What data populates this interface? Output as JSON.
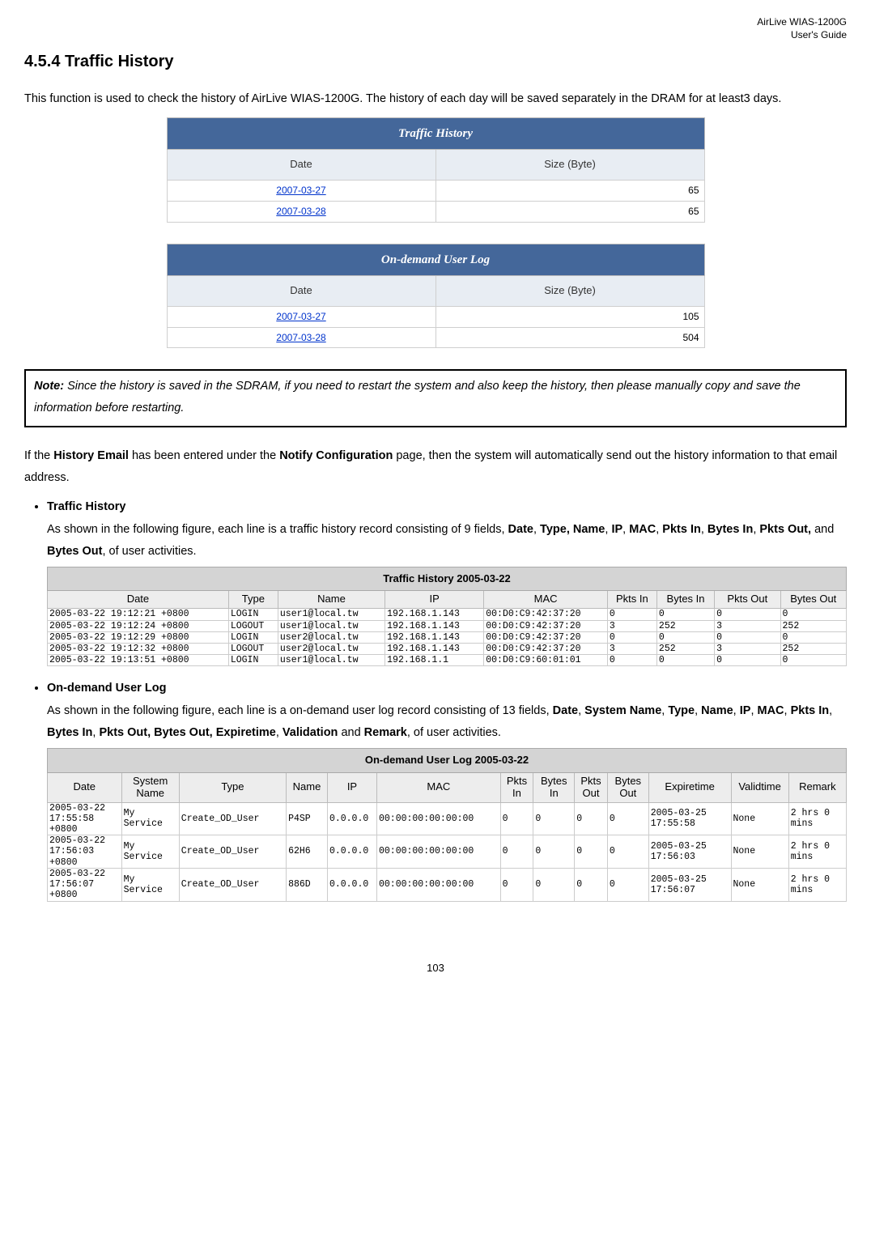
{
  "header": {
    "product": "AirLive WIAS-1200G",
    "doc": "User's Guide"
  },
  "section_title": "4.5.4 Traffic History",
  "intro": "This function is used to check the history of AirLive WIAS-1200G. The history of each day will be saved separately in the DRAM for at least3 days.",
  "summary_tables": [
    {
      "title": "Traffic History",
      "headers": [
        "Date",
        "Size (Byte)"
      ],
      "rows": [
        {
          "date": "2007-03-27",
          "size": "65"
        },
        {
          "date": "2007-03-28",
          "size": "65"
        }
      ]
    },
    {
      "title": "On-demand User Log",
      "headers": [
        "Date",
        "Size (Byte)"
      ],
      "rows": [
        {
          "date": "2007-03-27",
          "size": "105"
        },
        {
          "date": "2007-03-28",
          "size": "504"
        }
      ]
    }
  ],
  "note": {
    "label": "Note:",
    "text": " Since the history is saved in the SDRAM, if you need to restart the system and also keep the history, then please manually copy and save the information before restarting."
  },
  "after_note_pre": "If the ",
  "after_note_b1": "History Email",
  "after_note_mid": " has been entered under the ",
  "after_note_b2": "Notify Configuration",
  "after_note_post": " page, then the system will automatically send out the history information to that email address.",
  "bullets": [
    {
      "title": "Traffic History",
      "body_parts": [
        "As shown in the following figure, each line is a traffic history record consisting of 9 fields, ",
        "Date",
        ", ",
        "Type, Name",
        ", ",
        "IP",
        ", ",
        "MAC",
        ", ",
        "Pkts In",
        ", ",
        "Bytes In",
        ", ",
        "Pkts Out,",
        " and ",
        "Bytes Out",
        ", of user activities."
      ],
      "strong_indices": [
        1,
        3,
        5,
        7,
        9,
        11,
        13,
        15
      ]
    },
    {
      "title": "On-demand User Log",
      "body_parts": [
        "As shown in the following figure, each line is a on-demand user log record consisting of 13 fields, ",
        "Date",
        ", ",
        "System Name",
        ", ",
        "Type",
        ", ",
        "Name",
        ", ",
        "IP",
        ", ",
        "MAC",
        ", ",
        "Pkts In",
        ", ",
        "Bytes In",
        ", ",
        "Pkts Out, Bytes Out, Expiretime",
        ", ",
        "Validation",
        " and ",
        "Remark",
        ", of user activities."
      ],
      "strong_indices": [
        1,
        3,
        5,
        7,
        9,
        11,
        13,
        15,
        17,
        19,
        21
      ]
    }
  ],
  "traffic_detail": {
    "title": "Traffic History 2005-03-22",
    "headers": [
      "Date",
      "Type",
      "Name",
      "IP",
      "MAC",
      "Pkts In",
      "Bytes In",
      "Pkts Out",
      "Bytes Out"
    ],
    "rows": [
      [
        "2005-03-22 19:12:21 +0800",
        "LOGIN",
        "user1@local.tw",
        "192.168.1.143",
        "00:D0:C9:42:37:20",
        "0",
        "0",
        "0",
        "0"
      ],
      [
        "2005-03-22 19:12:24 +0800",
        "LOGOUT",
        "user1@local.tw",
        "192.168.1.143",
        "00:D0:C9:42:37:20",
        "3",
        "252",
        "3",
        "252"
      ],
      [
        "2005-03-22 19:12:29 +0800",
        "LOGIN",
        "user2@local.tw",
        "192.168.1.143",
        "00:D0:C9:42:37:20",
        "0",
        "0",
        "0",
        "0"
      ],
      [
        "2005-03-22 19:12:32 +0800",
        "LOGOUT",
        "user2@local.tw",
        "192.168.1.143",
        "00:D0:C9:42:37:20",
        "3",
        "252",
        "3",
        "252"
      ],
      [
        "2005-03-22 19:13:51 +0800",
        "LOGIN",
        "user1@local.tw",
        "192.168.1.1",
        "00:D0:C9:60:01:01",
        "0",
        "0",
        "0",
        "0"
      ]
    ]
  },
  "ondemand_detail": {
    "title": "On-demand User Log 2005-03-22",
    "headers": [
      "Date",
      "System Name",
      "Type",
      "Name",
      "IP",
      "MAC",
      "Pkts In",
      "Bytes In",
      "Pkts Out",
      "Bytes Out",
      "Expiretime",
      "Validtime",
      "Remark"
    ],
    "rows": [
      [
        "2005-03-22 17:55:58 +0800",
        "My Service",
        "Create_OD_User",
        "P4SP",
        "0.0.0.0",
        "00:00:00:00:00:00",
        "0",
        "0",
        "0",
        "0",
        "2005-03-25 17:55:58",
        "None",
        "2 hrs 0 mins"
      ],
      [
        "2005-03-22 17:56:03 +0800",
        "My Service",
        "Create_OD_User",
        "62H6",
        "0.0.0.0",
        "00:00:00:00:00:00",
        "0",
        "0",
        "0",
        "0",
        "2005-03-25 17:56:03",
        "None",
        "2 hrs 0 mins"
      ],
      [
        "2005-03-22 17:56:07 +0800",
        "My Service",
        "Create_OD_User",
        "886D",
        "0.0.0.0",
        "00:00:00:00:00:00",
        "0",
        "0",
        "0",
        "0",
        "2005-03-25 17:56:07",
        "None",
        "2 hrs 0 mins"
      ]
    ]
  },
  "page_number": "103"
}
